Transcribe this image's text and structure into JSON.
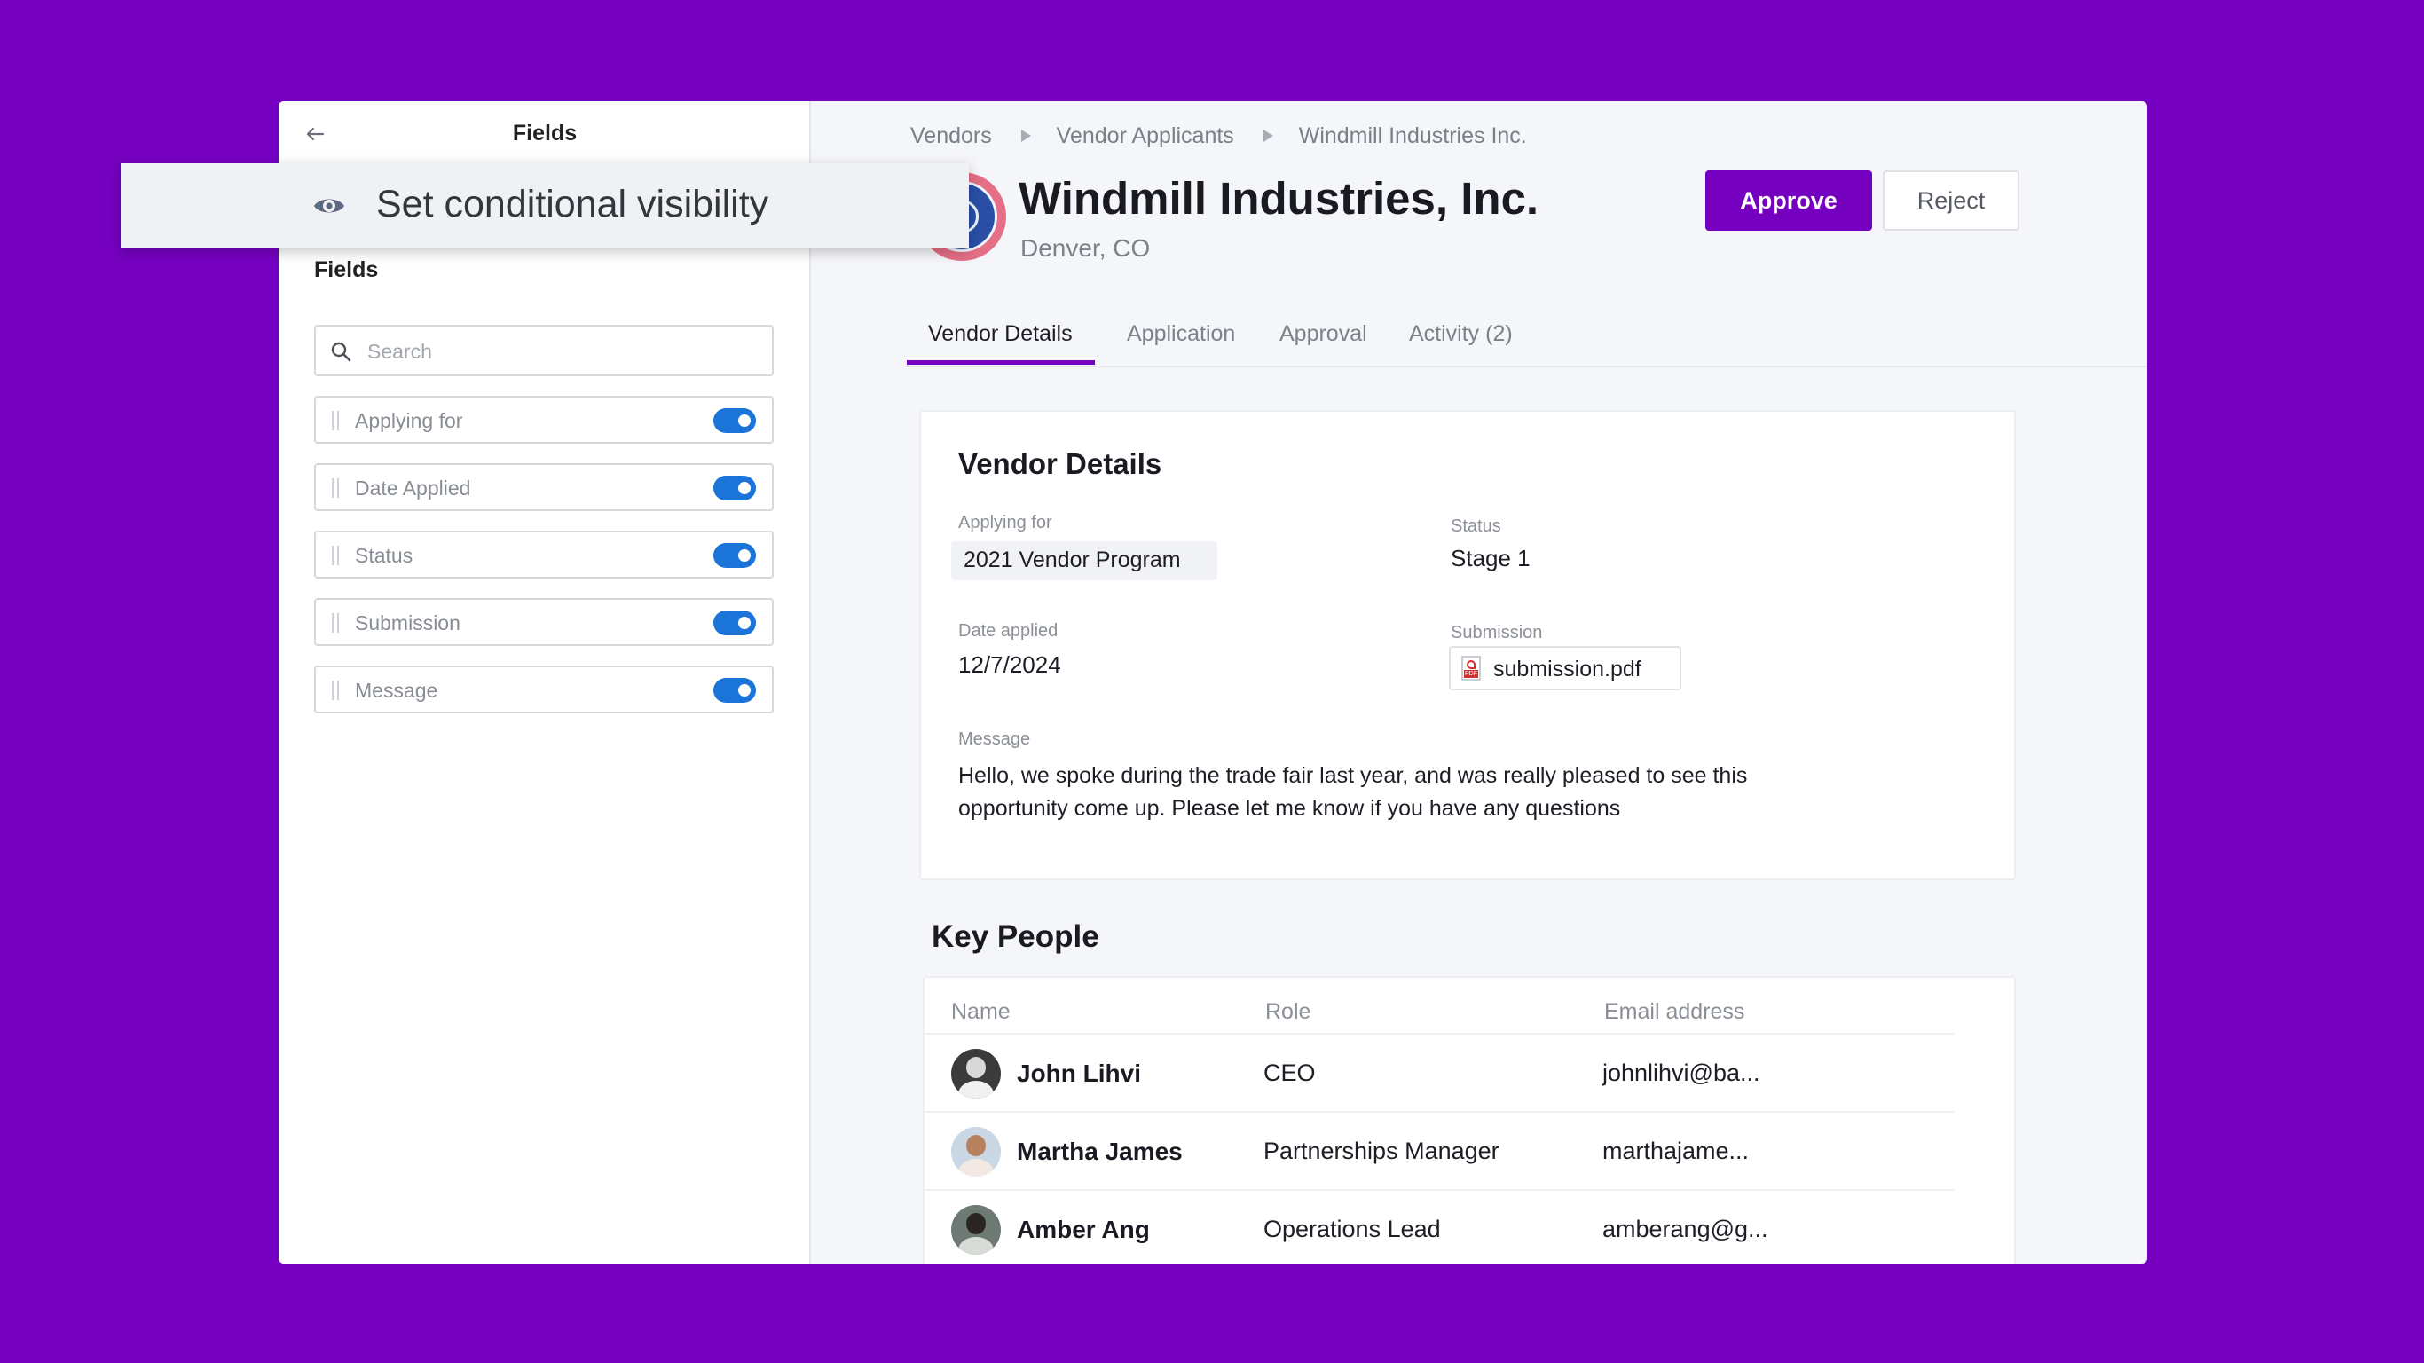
{
  "panel": {
    "title": "Fields",
    "section_label": "Fields",
    "search_placeholder": "Search",
    "fields": [
      {
        "label": "Applying for",
        "enabled": true
      },
      {
        "label": "Date Applied",
        "enabled": true
      },
      {
        "label": "Status",
        "enabled": true
      },
      {
        "label": "Submission",
        "enabled": true
      },
      {
        "label": "Message",
        "enabled": true
      }
    ]
  },
  "popover": {
    "icon": "eye-icon",
    "text": "Set conditional visibility"
  },
  "breadcrumb": [
    "Vendors",
    "Vendor Applicants",
    "Windmill Industries Inc."
  ],
  "header": {
    "company": "Windmill Industries, Inc.",
    "location": "Denver, CO",
    "approve_label": "Approve",
    "reject_label": "Reject"
  },
  "tabs": [
    "Vendor Details",
    "Application",
    "Approval",
    "Activity (2)"
  ],
  "details": {
    "title": "Vendor Details",
    "applying_for_label": "Applying for",
    "applying_for_value": "2021 Vendor Program",
    "status_label": "Status",
    "status_value": "Stage 1",
    "date_label": "Date applied",
    "date_value": "12/7/2024",
    "submission_label": "Submission",
    "submission_file": "submission.pdf",
    "message_label": "Message",
    "message_value": "Hello, we spoke during the trade fair last year, and was really pleased to see this opportunity come up. Please let me know if you have any questions"
  },
  "key_people": {
    "title": "Key People",
    "columns": [
      "Name",
      "Role",
      "Email address"
    ],
    "rows": [
      {
        "name": "John Lihvi",
        "role": "CEO",
        "email": "johnlihvi@ba..."
      },
      {
        "name": "Martha James",
        "role": "Partnerships Manager",
        "email": "marthajame..."
      },
      {
        "name": "Amber Ang",
        "role": "Operations Lead",
        "email": "amberang@g..."
      }
    ]
  },
  "colors": {
    "brand": "#7600c0",
    "toggle_on": "#1a74d9",
    "background": "#f5f6fa"
  }
}
